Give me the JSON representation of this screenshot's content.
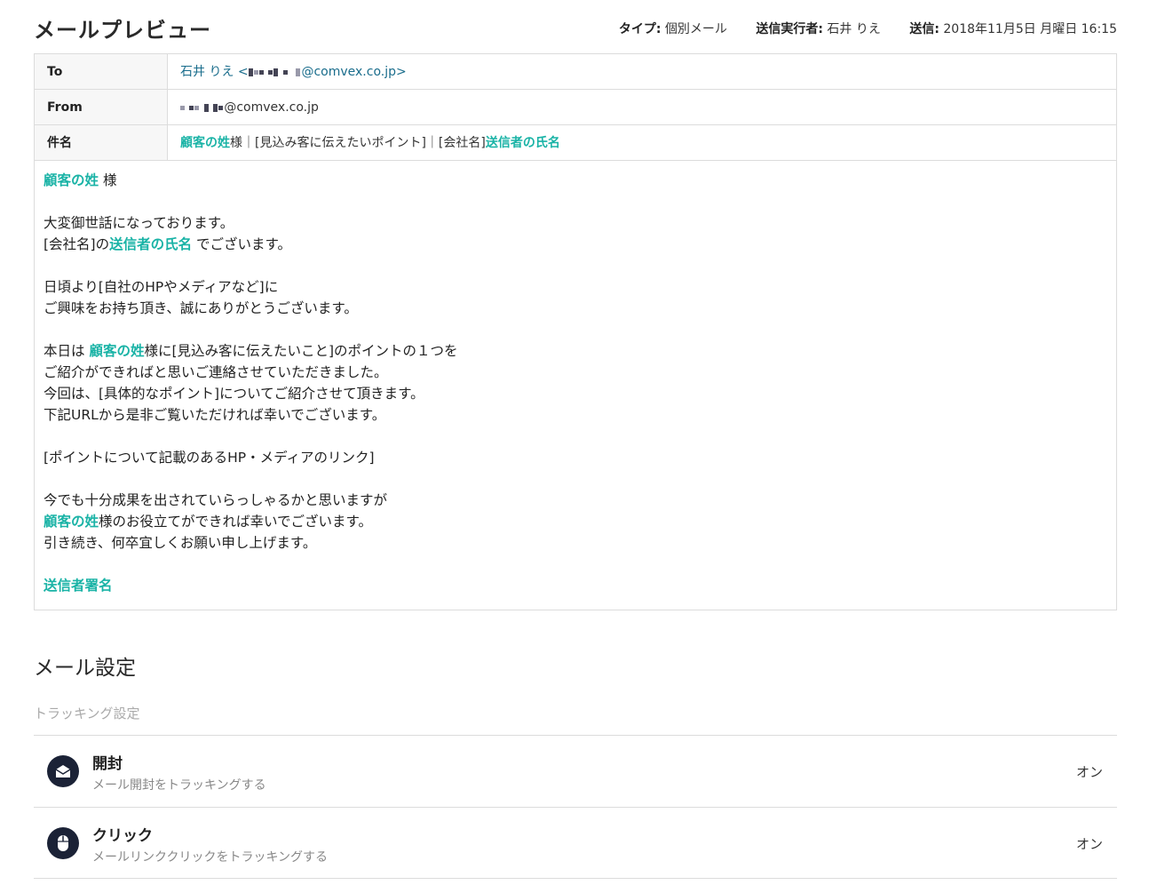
{
  "header": {
    "title": "メールプレビュー",
    "type_label": "タイプ:",
    "type_value": "個別メール",
    "sender_label": "送信実行者:",
    "sender_value": "石井 りえ",
    "sent_label": "送信:",
    "sent_value": "2018年11月5日 月曜日 16:15"
  },
  "mail": {
    "to_label": "To",
    "to_name": "石井 りえ <",
    "to_domain": "@comvex.co.jp>",
    "from_label": "From",
    "from_domain": "@comvex.co.jp",
    "subject_label": "件名",
    "subject_var1": "顧客の姓",
    "subject_mid": "様｜[見込み客に伝えたいポイント]｜[会社名]",
    "subject_var2": "送信者の氏名"
  },
  "body": {
    "l1_var": "顧客の姓",
    "l1_text": " 様",
    "l2": "大変御世話になっております。",
    "l3_pre": "[会社名]の",
    "l3_var": "送信者の氏名",
    "l3_post": " でございます。",
    "l4": "日頃より[自社のHPやメディアなど]に",
    "l5": "ご興味をお持ち頂き、誠にありがとうございます。",
    "l6_pre": "本日は ",
    "l6_var": "顧客の姓",
    "l6_post": "様に[見込み客に伝えたいこと]のポイントの１つを",
    "l7": "ご紹介ができればと思いご連絡させていただきました。",
    "l8": "今回は、[具体的なポイント]についてご紹介させて頂きます。",
    "l9": "下記URLから是非ご覧いただければ幸いでございます。",
    "l10": "[ポイントについて記載のあるHP・メディアのリンク]",
    "l11": "今でも十分成果を出されていらっしゃるかと思いますが",
    "l12_var": "顧客の姓",
    "l12_post": "様のお役立てができれば幸いでございます。",
    "l13": "引き続き、何卒宜しくお願い申し上げます。",
    "signature": "送信者署名"
  },
  "settings": {
    "title": "メール設定",
    "tracking_label": "トラッキング設定",
    "items": [
      {
        "name": "開封",
        "desc": "メール開封をトラッキングする",
        "status": "オン",
        "icon": "envelope-open-icon"
      },
      {
        "name": "クリック",
        "desc": "メールリンククリックをトラッキングする",
        "status": "オン",
        "icon": "mouse-icon"
      }
    ]
  },
  "colors": {
    "accent": "#1ab3a6",
    "link": "#1a6d8c",
    "icon_bg": "#1b2236"
  }
}
